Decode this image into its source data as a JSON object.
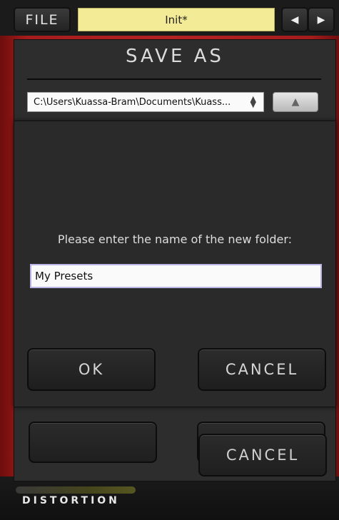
{
  "topbar": {
    "file_label": "FILE",
    "preset_name": "Init*",
    "prev_icon": "left-arrow-icon",
    "next_icon": "right-arrow-icon"
  },
  "save_as": {
    "title": "SAVE AS",
    "path_value": "C:\\Users\\Kuassa-Bram\\Documents\\Kuass...",
    "up_icon": "up-arrow-icon",
    "cancel_label": "CANCEL"
  },
  "dialog": {
    "prompt": "Please enter the name of the new folder:",
    "folder_name": "My Presets",
    "ok_label": "OK",
    "cancel_label": "CANCEL"
  },
  "brand": {
    "product": "DISTORTION"
  },
  "colors": {
    "chassis_red": "#b42222",
    "preset_yellow": "#f3eb96",
    "panel_dark": "#2a2a2a"
  }
}
